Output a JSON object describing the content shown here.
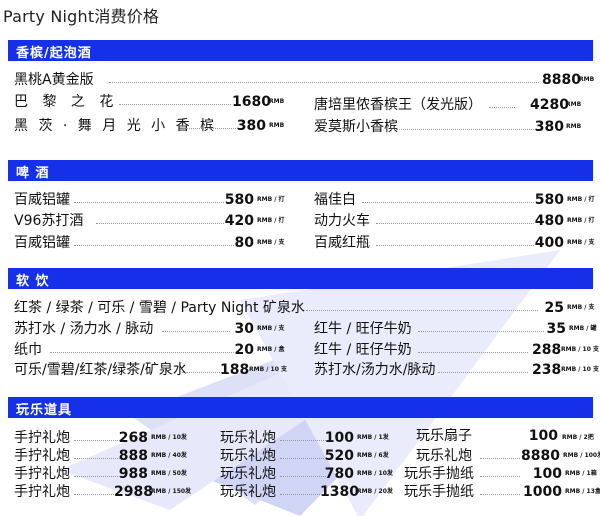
{
  "page_title": "Party Night消费价格",
  "sections": {
    "champagne": "香槟/起泡酒",
    "beer": "啤 酒",
    "soft": "软 饮",
    "props": "玩乐道具"
  },
  "champagne": [
    {
      "name": "黑桃A黄金版",
      "price": "8880",
      "unit": "RMB"
    },
    {
      "name": "巴 黎 之 花",
      "price": "1680",
      "unit": "RMB"
    },
    {
      "name": "唐培里侬香槟王（发光版）",
      "price": "4280",
      "unit": "RMB"
    },
    {
      "name": "黑 茨 · 舞 月 光 小 香 槟",
      "price": "380",
      "unit": "RMB"
    },
    {
      "name": "爱莫斯小香槟",
      "price": "380",
      "unit": "RMB"
    }
  ],
  "beer": [
    {
      "name": "百威铝罐",
      "price": "580",
      "unit": "RMB / 打"
    },
    {
      "name": "福佳白",
      "price": "580",
      "unit": "RMB / 打"
    },
    {
      "name": "V96苏打酒",
      "price": "420",
      "unit": "RMB / 打"
    },
    {
      "name": "动力火车",
      "price": "480",
      "unit": "RMB / 打"
    },
    {
      "name": "百威铝罐",
      "price": "80",
      "unit": "RMB / 支"
    },
    {
      "name": "百威红瓶",
      "price": "400",
      "unit": "RMB / 支"
    }
  ],
  "soft": [
    {
      "name": "红茶 / 绿茶 / 可乐 / 雪碧 / Party Night 矿泉水",
      "price": "25",
      "unit": "RMB / 支"
    },
    {
      "name": "苏打水 / 汤力水 / 脉动",
      "price": "30",
      "unit": "RMB / 支"
    },
    {
      "name": "红牛 / 旺仔牛奶",
      "price": "35",
      "unit": "RMB / 罐"
    },
    {
      "name": "纸巾",
      "price": "20",
      "unit": "RMB / 盒"
    },
    {
      "name": "红牛 / 旺仔牛奶",
      "price": "288",
      "unit": "RMB / 10 支"
    },
    {
      "name": "可乐/雪碧/红茶/绿茶/矿泉水",
      "price": "188",
      "unit": "RMB / 10 支"
    },
    {
      "name": "苏打水/汤力水/脉动",
      "price": "238",
      "unit": "RMB / 10 支"
    }
  ],
  "props": [
    {
      "name": "手拧礼炮",
      "price": "268",
      "unit": "RMB / 10发"
    },
    {
      "name": "玩乐礼炮",
      "price": "100",
      "unit": "RMB / 1发"
    },
    {
      "name": "玩乐扇子",
      "price": "100",
      "unit": "RMB / 2把"
    },
    {
      "name": "手拧礼炮",
      "price": "888",
      "unit": "RMB / 40发"
    },
    {
      "name": "玩乐礼炮",
      "price": "520",
      "unit": "RMB / 6发"
    },
    {
      "name": "玩乐礼炮",
      "price": "8880",
      "unit": "RMB / 100发"
    },
    {
      "name": "手拧礼炮",
      "price": "988",
      "unit": "RMB / 50发"
    },
    {
      "name": "玩乐礼炮",
      "price": "780",
      "unit": "RMB / 10发"
    },
    {
      "name": "玩乐手抛纸",
      "price": "100",
      "unit": "RMB / 1箱"
    },
    {
      "name": "手拧礼炮",
      "price": "2988",
      "unit": "RMB / 150发"
    },
    {
      "name": "玩乐礼炮",
      "price": "1380",
      "unit": "RMB / 20发"
    },
    {
      "name": "玩乐手抛纸",
      "price": "1000",
      "unit": "RMB / 13盒"
    }
  ],
  "colors": {
    "section_bg": "#1530e8",
    "watermark": "#c8ccf4"
  }
}
